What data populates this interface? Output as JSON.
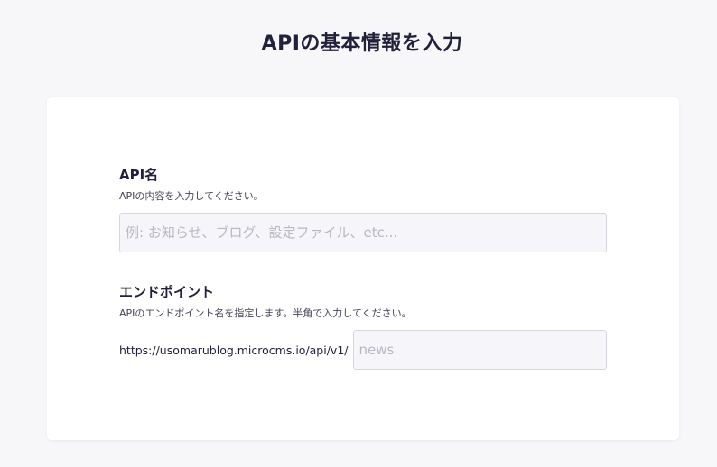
{
  "page": {
    "title": "APIの基本情報を入力"
  },
  "form": {
    "api_name": {
      "label": "API名",
      "description": "APIの内容を入力してください。",
      "placeholder": "例: お知らせ、ブログ、設定ファイル、etc...",
      "value": ""
    },
    "endpoint": {
      "label": "エンドポイント",
      "description": "APIのエンドポイント名を指定します。半角で入力してください。",
      "prefix": "https://usomarublog.microcms.io/api/v1/",
      "placeholder": "news",
      "value": ""
    }
  }
}
